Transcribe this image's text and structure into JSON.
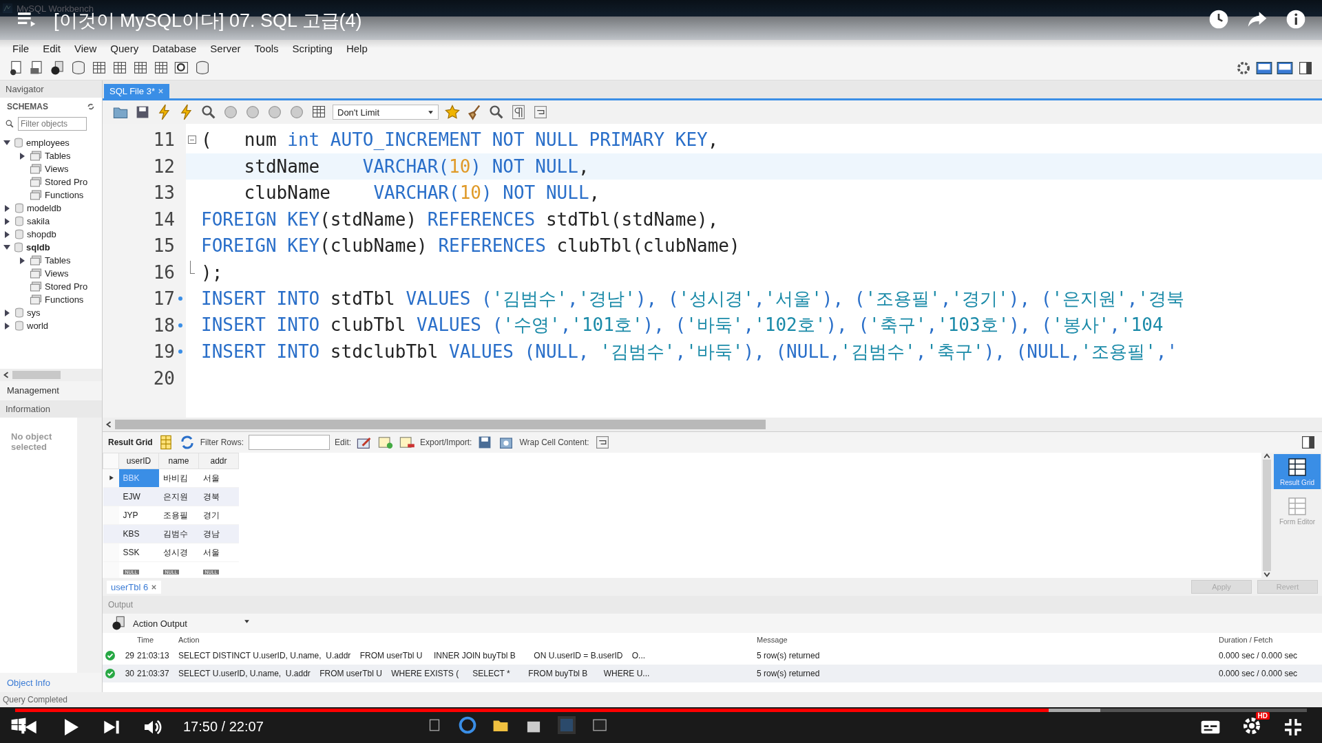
{
  "video": {
    "title": "[이것이 MySQL이다] 07. SQL 고급(4)",
    "time": "17:50 / 22:07",
    "level": 0.8,
    "hd_badge": "HD"
  },
  "window": {
    "title": "MySQL Workbench"
  },
  "menu": [
    "File",
    "Edit",
    "View",
    "Query",
    "Database",
    "Server",
    "Tools",
    "Scripting",
    "Help"
  ],
  "navigator": {
    "title": "Navigator",
    "schemas_label": "SCHEMAS",
    "filter_placeholder": "Filter objects",
    "tree": [
      {
        "label": "employees",
        "expanded": true,
        "bold": false,
        "children": [
          {
            "label": "Tables",
            "expanded": false,
            "bold": false
          },
          {
            "label": "Views",
            "bold": false
          },
          {
            "label": "Stored Pro",
            "bold": false
          },
          {
            "label": "Functions",
            "bold": false
          }
        ]
      },
      {
        "label": "modeldb",
        "expanded": false,
        "bold": false
      },
      {
        "label": "sakila",
        "expanded": false,
        "bold": false
      },
      {
        "label": "shopdb",
        "expanded": false,
        "bold": false
      },
      {
        "label": "sqldb",
        "expanded": true,
        "bold": true,
        "children": [
          {
            "label": "Tables",
            "expanded": false,
            "bold": false
          },
          {
            "label": "Views",
            "bold": false
          },
          {
            "label": "Stored Pro",
            "bold": false
          },
          {
            "label": "Functions",
            "bold": false
          }
        ]
      },
      {
        "label": "sys",
        "expanded": false,
        "bold": false
      },
      {
        "label": "world",
        "expanded": false,
        "bold": false
      }
    ],
    "management_label": "Management",
    "information_label": "Information",
    "no_object": "No object selected",
    "object_info_label": "Object Info"
  },
  "editor": {
    "tab": "SQL File 3*",
    "limit": "Don't Limit",
    "lines": [
      {
        "number": "11",
        "fold_start": true,
        "fold_end": false,
        "statement": false,
        "current": false,
        "tokens": [
          {
            "text": "(   ",
            "kind": "punct"
          },
          {
            "text": "num ",
            "kind": "id"
          },
          {
            "text": "int AUTO_INCREMENT NOT NULL PRIMARY KEY",
            "kind": "kw"
          },
          {
            "text": ",",
            "kind": "punct"
          }
        ]
      },
      {
        "number": "12",
        "fold_start": false,
        "fold_end": false,
        "statement": false,
        "current": true,
        "tokens": [
          {
            "text": "    stdName    ",
            "kind": "id"
          },
          {
            "text": "VARCHAR(",
            "kind": "kw"
          },
          {
            "text": "10",
            "kind": "num"
          },
          {
            "text": ") NOT NULL",
            "kind": "kw"
          },
          {
            "text": ",",
            "kind": "punct"
          }
        ]
      },
      {
        "number": "13",
        "fold_start": false,
        "fold_end": false,
        "statement": false,
        "current": false,
        "tokens": [
          {
            "text": "    clubName    ",
            "kind": "id"
          },
          {
            "text": "VARCHAR(",
            "kind": "kw"
          },
          {
            "text": "10",
            "kind": "num"
          },
          {
            "text": ") NOT NULL",
            "kind": "kw"
          },
          {
            "text": ",",
            "kind": "punct"
          }
        ]
      },
      {
        "number": "14",
        "fold_start": false,
        "fold_end": false,
        "statement": false,
        "current": false,
        "tokens": [
          {
            "text": "FOREIGN KEY",
            "kind": "kw"
          },
          {
            "text": "(stdName) ",
            "kind": "id"
          },
          {
            "text": "REFERENCES ",
            "kind": "kw"
          },
          {
            "text": "stdTbl(stdName),",
            "kind": "id"
          }
        ]
      },
      {
        "number": "15",
        "fold_start": false,
        "fold_end": false,
        "statement": false,
        "current": false,
        "tokens": [
          {
            "text": "FOREIGN KEY",
            "kind": "kw"
          },
          {
            "text": "(clubName) ",
            "kind": "id"
          },
          {
            "text": "REFERENCES ",
            "kind": "kw"
          },
          {
            "text": "clubTbl(clubName)",
            "kind": "id"
          }
        ]
      },
      {
        "number": "16",
        "fold_start": false,
        "fold_end": true,
        "statement": false,
        "current": false,
        "tokens": [
          {
            "text": ");",
            "kind": "punct"
          }
        ]
      },
      {
        "number": "17",
        "fold_start": false,
        "fold_end": false,
        "statement": true,
        "current": false,
        "tokens": [
          {
            "text": "INSERT INTO ",
            "kind": "kw"
          },
          {
            "text": "stdTbl ",
            "kind": "id"
          },
          {
            "text": "VALUES (",
            "kind": "kw"
          },
          {
            "text": "'김범수'",
            "kind": "str"
          },
          {
            "text": ",",
            "kind": "kw"
          },
          {
            "text": "'경남'",
            "kind": "str"
          },
          {
            "text": "), (",
            "kind": "kw"
          },
          {
            "text": "'성시경'",
            "kind": "str"
          },
          {
            "text": ",",
            "kind": "kw"
          },
          {
            "text": "'서울'",
            "kind": "str"
          },
          {
            "text": "), (",
            "kind": "kw"
          },
          {
            "text": "'조용필'",
            "kind": "str"
          },
          {
            "text": ",",
            "kind": "kw"
          },
          {
            "text": "'경기'",
            "kind": "str"
          },
          {
            "text": "), (",
            "kind": "kw"
          },
          {
            "text": "'은지원'",
            "kind": "str"
          },
          {
            "text": ",",
            "kind": "kw"
          },
          {
            "text": "'경북",
            "kind": "str"
          }
        ]
      },
      {
        "number": "18",
        "fold_start": false,
        "fold_end": false,
        "statement": true,
        "current": false,
        "tokens": [
          {
            "text": "INSERT INTO ",
            "kind": "kw"
          },
          {
            "text": "clubTbl ",
            "kind": "id"
          },
          {
            "text": "VALUES (",
            "kind": "kw"
          },
          {
            "text": "'수영'",
            "kind": "str"
          },
          {
            "text": ",",
            "kind": "kw"
          },
          {
            "text": "'101호'",
            "kind": "str"
          },
          {
            "text": "), (",
            "kind": "kw"
          },
          {
            "text": "'바둑'",
            "kind": "str"
          },
          {
            "text": ",",
            "kind": "kw"
          },
          {
            "text": "'102호'",
            "kind": "str"
          },
          {
            "text": "), (",
            "kind": "kw"
          },
          {
            "text": "'축구'",
            "kind": "str"
          },
          {
            "text": ",",
            "kind": "kw"
          },
          {
            "text": "'103호'",
            "kind": "str"
          },
          {
            "text": "), (",
            "kind": "kw"
          },
          {
            "text": "'봉사'",
            "kind": "str"
          },
          {
            "text": ",",
            "kind": "kw"
          },
          {
            "text": "'104",
            "kind": "str"
          }
        ]
      },
      {
        "number": "19",
        "fold_start": false,
        "fold_end": false,
        "statement": true,
        "current": false,
        "tokens": [
          {
            "text": "INSERT INTO ",
            "kind": "kw"
          },
          {
            "text": "stdclubTbl ",
            "kind": "id"
          },
          {
            "text": "VALUES (NULL, ",
            "kind": "kw"
          },
          {
            "text": "'김범수'",
            "kind": "str"
          },
          {
            "text": ",",
            "kind": "kw"
          },
          {
            "text": "'바둑'",
            "kind": "str"
          },
          {
            "text": "), (NULL,",
            "kind": "kw"
          },
          {
            "text": "'김범수'",
            "kind": "str"
          },
          {
            "text": ",",
            "kind": "kw"
          },
          {
            "text": "'축구'",
            "kind": "str"
          },
          {
            "text": "), (NULL,",
            "kind": "kw"
          },
          {
            "text": "'조용필'",
            "kind": "str"
          },
          {
            "text": ",'",
            "kind": "kw"
          }
        ]
      },
      {
        "number": "20",
        "fold_start": false,
        "fold_end": false,
        "statement": false,
        "current": false
      }
    ]
  },
  "result": {
    "toolbar": {
      "result_grid": "Result Grid",
      "filter_rows": "Filter Rows:",
      "edit": "Edit:",
      "export_import": "Export/Import:",
      "wrap": "Wrap Cell Content:"
    },
    "columns": [
      "userID",
      "name",
      "addr"
    ],
    "rows": [
      {
        "selected": true,
        "cells": [
          "BBK",
          "바비킴",
          "서울"
        ]
      },
      {
        "selected": false,
        "cells": [
          "EJW",
          "은지원",
          "경북"
        ]
      },
      {
        "selected": false,
        "cells": [
          "JYP",
          "조용필",
          "경기"
        ]
      },
      {
        "selected": false,
        "cells": [
          "KBS",
          "김범수",
          "경남"
        ]
      },
      {
        "selected": false,
        "cells": [
          "SSK",
          "성시경",
          "서울"
        ]
      }
    ],
    "null_row": [
      "NULL",
      "NULL",
      "NULL"
    ],
    "side": [
      {
        "label": "Result Grid",
        "selected": true
      },
      {
        "label": "Form Editor",
        "selected": false
      }
    ],
    "tab": "userTbl 6",
    "apply": "Apply",
    "revert": "Revert"
  },
  "output": {
    "title": "Output",
    "mode": "Action Output",
    "columns": [
      "Time",
      "Action",
      "Message",
      "Duration / Fetch"
    ],
    "rows": [
      {
        "ok": true,
        "selected": false,
        "number": "29",
        "time": "21:03:13",
        "action": "SELECT DISTINCT U.userID, U.name,  U.addr    FROM userTbl U     INNER JOIN buyTbl B        ON U.userID = B.userID    O...",
        "message": "5 row(s) returned",
        "duration": "0.000 sec / 0.000 sec"
      },
      {
        "ok": true,
        "selected": true,
        "number": "30",
        "time": "21:03:37",
        "action": "SELECT U.userID, U.name,  U.addr    FROM userTbl U    WHERE EXISTS (      SELECT *        FROM buyTbl B       WHERE U...",
        "message": "5 row(s) returned",
        "duration": "0.000 sec / 0.000 sec"
      }
    ]
  },
  "status_bar": "Query Completed"
}
